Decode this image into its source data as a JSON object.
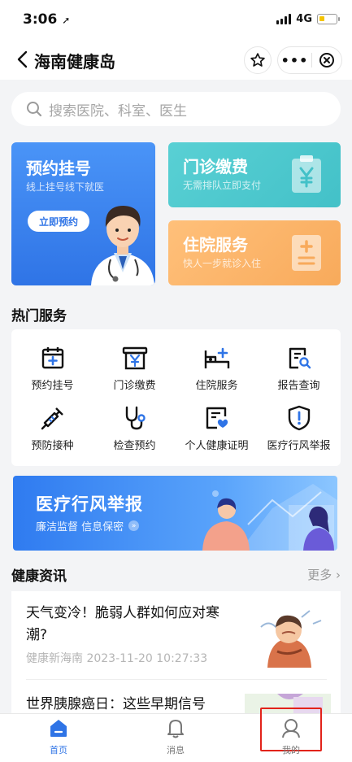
{
  "status_bar": {
    "time": "3:06",
    "network": "4G"
  },
  "nav": {
    "title": "海南健康岛"
  },
  "search": {
    "placeholder": "搜索医院、科室、医生"
  },
  "cards": {
    "appointment": {
      "title": "预约挂号",
      "subtitle": "线上挂号线下就医",
      "button": "立即预约"
    },
    "clinic_payment": {
      "title": "门诊缴费",
      "subtitle": "无需排队立即支付"
    },
    "inpatient": {
      "title": "住院服务",
      "subtitle": "快人一步就诊入住"
    }
  },
  "hot_services": {
    "title": "热门服务",
    "items": [
      {
        "label": "预约挂号",
        "icon": "calendar-plus-icon"
      },
      {
        "label": "门诊缴费",
        "icon": "yen-receipt-icon"
      },
      {
        "label": "住院服务",
        "icon": "hospital-bed-icon"
      },
      {
        "label": "报告查询",
        "icon": "report-search-icon"
      },
      {
        "label": "预防接种",
        "icon": "syringe-icon"
      },
      {
        "label": "检查预约",
        "icon": "stethoscope-icon"
      },
      {
        "label": "个人健康证明",
        "icon": "health-certificate-icon"
      },
      {
        "label": "医疗行风举报",
        "icon": "shield-alert-icon"
      }
    ]
  },
  "banner": {
    "title": "医疗行风举报",
    "subtitle": "廉洁监督 信息保密",
    "arrow": "»"
  },
  "news": {
    "title": "健康资讯",
    "more": "更多",
    "items": [
      {
        "title": "天气变冷！脆弱人群如何应对寒潮?",
        "meta": "健康新海南 2023-11-20 10:27:33"
      },
      {
        "title": "世界胰腺癌日：这些早期信号",
        "meta": ""
      }
    ]
  },
  "tabbar": {
    "items": [
      {
        "label": "首页",
        "active": true
      },
      {
        "label": "消息",
        "active": false
      },
      {
        "label": "我的",
        "active": false
      }
    ]
  },
  "colors": {
    "primary": "#2f74e6",
    "teal": "#43c1c8",
    "orange": "#f8aa5b",
    "highlight": "#e2231a"
  }
}
